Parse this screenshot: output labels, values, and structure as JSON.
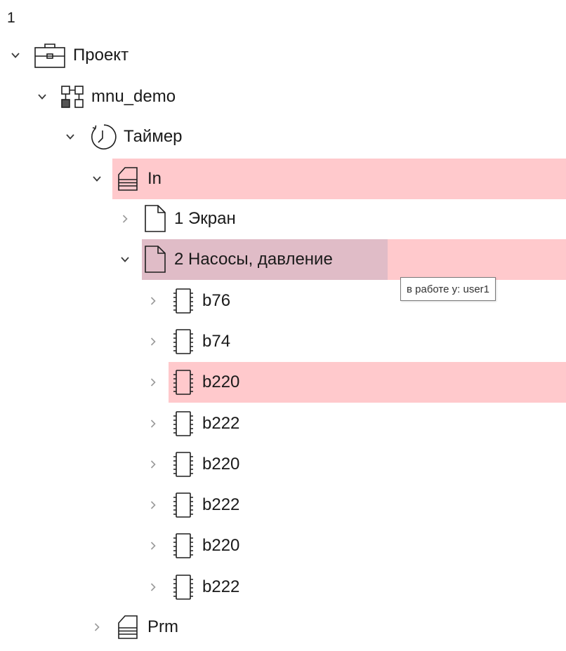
{
  "header": {
    "title": "1"
  },
  "tree": {
    "nodes": [
      {
        "label": "Проект",
        "icon": "briefcase-icon",
        "chevron": "down"
      },
      {
        "label": "mnu_demo",
        "icon": "network-icon",
        "chevron": "down"
      },
      {
        "label": "Таймер",
        "icon": "timer-icon",
        "chevron": "down"
      },
      {
        "label": "In",
        "icon": "stack-icon",
        "chevron": "down",
        "highlighted": true
      },
      {
        "label": "1 Экран",
        "icon": "page-icon",
        "chevron": "right"
      },
      {
        "label": "2 Насосы, давление",
        "icon": "page-icon",
        "chevron": "down",
        "highlighted": true,
        "selected": true
      },
      {
        "label": "b76",
        "icon": "chip-icon",
        "chevron": "right"
      },
      {
        "label": "b74",
        "icon": "chip-icon",
        "chevron": "right"
      },
      {
        "label": "b220",
        "icon": "chip-icon",
        "chevron": "right",
        "highlighted": true
      },
      {
        "label": "b222",
        "icon": "chip-icon",
        "chevron": "right"
      },
      {
        "label": "b220",
        "icon": "chip-icon",
        "chevron": "right"
      },
      {
        "label": "b222",
        "icon": "chip-icon",
        "chevron": "right"
      },
      {
        "label": "b220",
        "icon": "chip-icon",
        "chevron": "right"
      },
      {
        "label": "b222",
        "icon": "chip-icon",
        "chevron": "right"
      },
      {
        "label": "Prm",
        "icon": "stack-icon",
        "chevron": "right"
      }
    ]
  },
  "tooltip": {
    "text": "в работе у: user1"
  },
  "colors": {
    "highlight": "#ffc9cc",
    "selected": "#e0bcc7"
  }
}
